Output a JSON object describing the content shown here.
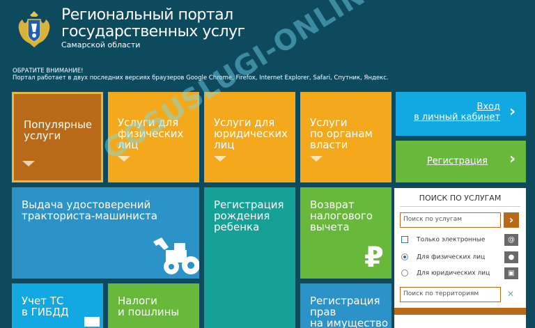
{
  "header": {
    "title_line1": "Региональный портал",
    "title_line2": "государственных услуг",
    "subtitle": "Самарской области",
    "emblem_icon": "coat-of-arms-icon"
  },
  "notice": {
    "line1": "ОБРАТИТЕ ВНИМАНИЕ!",
    "line2": "Портал работает в двух последних версиях браузеров Googlе Chrome, Firefox, Internet Explorer, Safari, Спутник, Яндекс."
  },
  "tiles": {
    "popular": "Популярные\nуслуги",
    "individuals": "Услуги для\nфизических\nлиц",
    "legal": "Услуги для\nюридических\nлиц",
    "authorities": "Услуги\nпо органам\nвласти",
    "login": "Вход\nв личный кабинет",
    "registration": "Регистрация",
    "tractor": "Выдача удостоверений\nтракториста-машиниста",
    "birth": "Регистрация\nрождения\nребенка",
    "tax_refund": "Возврат\nналогового\nвычета",
    "vehicle": "Учет ТС\nв ГИБДД",
    "taxes": "Налоги\nи пошлины",
    "property": "Регистрация\nправ\nна имущество"
  },
  "search": {
    "title": "ПОИСК ПО УСЛУГАМ",
    "placeholder": "Поиск по услугам",
    "only_electronic": "Только электронные",
    "for_individuals": "Для физических лиц",
    "for_legal": "Для юридических лиц",
    "territory_placeholder": "Поиск по территориям",
    "clear": "✕"
  },
  "watermark": "GOSUSLUGI-ONLINE.RU",
  "colors": {
    "background": "#0d4a5e",
    "orange": "#f4a91c",
    "dark_orange": "#b86a18",
    "blue": "#2c93c9",
    "sky": "#12a9e2",
    "green": "#67b83b",
    "teal": "#16a197"
  }
}
